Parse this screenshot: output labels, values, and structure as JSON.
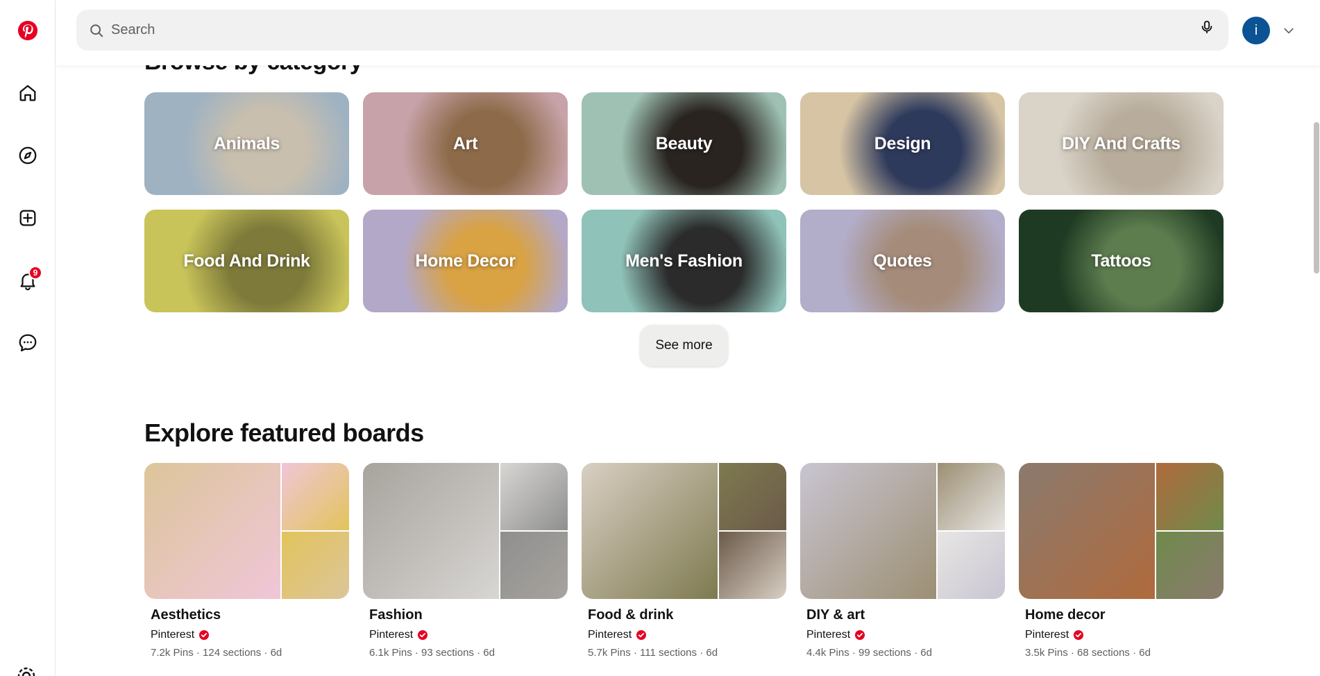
{
  "app": {
    "brand_color": "#e60023",
    "logo_icon": "pinterest-logo"
  },
  "sidebar": {
    "items": [
      {
        "name": "home",
        "icon": "home-icon"
      },
      {
        "name": "explore",
        "icon": "compass-icon"
      },
      {
        "name": "create",
        "icon": "plus-square-icon"
      },
      {
        "name": "notifications",
        "icon": "bell-icon",
        "badge": "9"
      },
      {
        "name": "messages",
        "icon": "chat-icon"
      }
    ]
  },
  "header": {
    "search_placeholder": "Search",
    "avatar_letter": "i",
    "avatar_color": "#0b5394"
  },
  "browse": {
    "title": "Browse by category",
    "categories": [
      {
        "label": "Animals",
        "colors": [
          "#9fb2c2",
          "#c9bfae"
        ]
      },
      {
        "label": "Art",
        "colors": [
          "#c7a2a8",
          "#8d6b4a"
        ]
      },
      {
        "label": "Beauty",
        "colors": [
          "#9ec1b3",
          "#2a2420"
        ]
      },
      {
        "label": "Design",
        "colors": [
          "#d6c4a5",
          "#2e3a5c"
        ]
      },
      {
        "label": "DIY And Crafts",
        "colors": [
          "#d9d3c8",
          "#b8ad9c"
        ]
      },
      {
        "label": "Food And Drink",
        "colors": [
          "#c9c45a",
          "#7d7a3a"
        ]
      },
      {
        "label": "Home Decor",
        "colors": [
          "#b3a8c8",
          "#d9a243"
        ]
      },
      {
        "label": "Men's Fashion",
        "colors": [
          "#8fc2b8",
          "#2b2b2b"
        ]
      },
      {
        "label": "Quotes",
        "colors": [
          "#b2adc9",
          "#a58c7a"
        ]
      },
      {
        "label": "Tattoos",
        "colors": [
          "#1f3a22",
          "#5e7d4f"
        ]
      }
    ],
    "see_more": "See more"
  },
  "featured": {
    "title": "Explore featured boards",
    "boards": [
      {
        "name": "Aesthetics",
        "owner": "Pinterest",
        "meta": "7.2k Pins · 124 sections · 6d",
        "colors": [
          "#dcc59a",
          "#f0c6d8",
          "#e2c45b"
        ]
      },
      {
        "name": "Fashion",
        "owner": "Pinterest",
        "meta": "6.1k Pins · 93 sections · 6d",
        "colors": [
          "#a7a39d",
          "#d8d6d3",
          "#8f8f8f"
        ]
      },
      {
        "name": "Food & drink",
        "owner": "Pinterest",
        "meta": "5.7k Pins · 111 sections · 6d",
        "colors": [
          "#d9cfc4",
          "#7e7a4f",
          "#6b5a49"
        ]
      },
      {
        "name": "DIY & art",
        "owner": "Pinterest",
        "meta": "4.4k Pins · 99 sections · 6d",
        "colors": [
          "#c9c5d2",
          "#9c8f73",
          "#e8e6e4"
        ]
      },
      {
        "name": "Home decor",
        "owner": "Pinterest",
        "meta": "3.5k Pins · 68 sections · 6d",
        "colors": [
          "#8a7a6e",
          "#b06a3c",
          "#6f8a4b"
        ]
      }
    ]
  }
}
